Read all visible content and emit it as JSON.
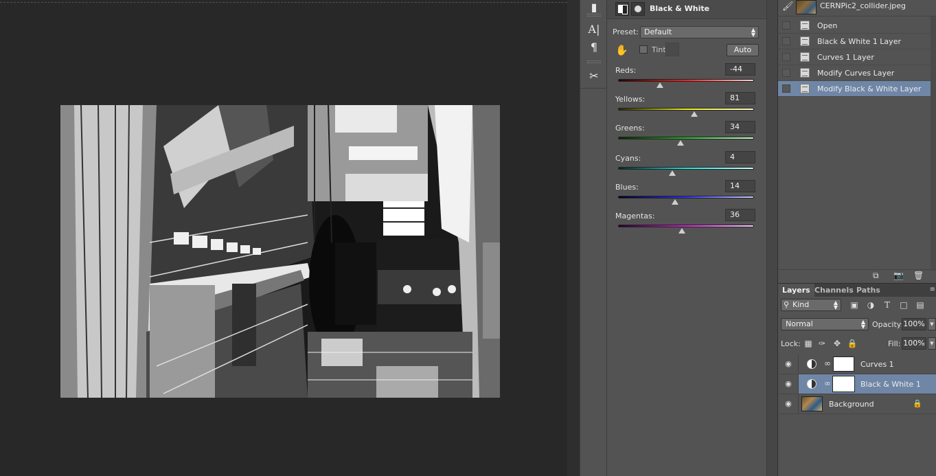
{
  "properties": {
    "title": "Black & White",
    "preset_label": "Preset:",
    "preset_value": "Default",
    "tint_label": "Tint",
    "auto_label": "Auto",
    "sliders": [
      {
        "label": "Reds:",
        "value": "-44",
        "gradient": "linear-gradient(90deg,#2a0000,#ff2020,#ffd0d0)",
        "fraction": 0.31
      },
      {
        "label": "Yellows:",
        "value": "81",
        "gradient": "linear-gradient(90deg,#2a2a00,#f0f020,#ffffd0)",
        "fraction": 0.56
      },
      {
        "label": "Greens:",
        "value": "34",
        "gradient": "linear-gradient(90deg,#002a00,#20c020,#d0ffd0)",
        "fraction": 0.46
      },
      {
        "label": "Cyans:",
        "value": "4",
        "gradient": "linear-gradient(90deg,#002a2a,#20e0e0,#d0ffff)",
        "fraction": 0.4
      },
      {
        "label": "Blues:",
        "value": "14",
        "gradient": "linear-gradient(90deg,#00002a,#3030ff,#d0d0ff)",
        "fraction": 0.42
      },
      {
        "label": "Magentas:",
        "value": "36",
        "gradient": "linear-gradient(90deg,#2a002a,#e020e0,#ffd0ff)",
        "fraction": 0.47
      }
    ]
  },
  "history": {
    "snapshot_name": "CERNPic2_collider.jpeg",
    "items": [
      {
        "label": "Open",
        "selected": false
      },
      {
        "label": "Black & White 1 Layer",
        "selected": false
      },
      {
        "label": "Curves 1 Layer",
        "selected": false
      },
      {
        "label": "Modify Curves Layer",
        "selected": false
      },
      {
        "label": "Modify Black & White Layer",
        "selected": true
      }
    ]
  },
  "layers_panel": {
    "tabs": [
      "Layers",
      "Channels",
      "Paths"
    ],
    "kind_label": "Kind",
    "blend_mode": "Normal",
    "opacity_label": "Opacity:",
    "opacity_value": "100%",
    "lock_label": "Lock:",
    "fill_label": "Fill:",
    "fill_value": "100%",
    "layers": [
      {
        "name": "Curves 1",
        "selected": false
      },
      {
        "name": "Black & White 1",
        "selected": true
      },
      {
        "name": "Background",
        "selected": false
      }
    ]
  },
  "colors": {
    "selection": "#6f86a6",
    "panel": "#535353",
    "canvas_bg": "#282828"
  }
}
